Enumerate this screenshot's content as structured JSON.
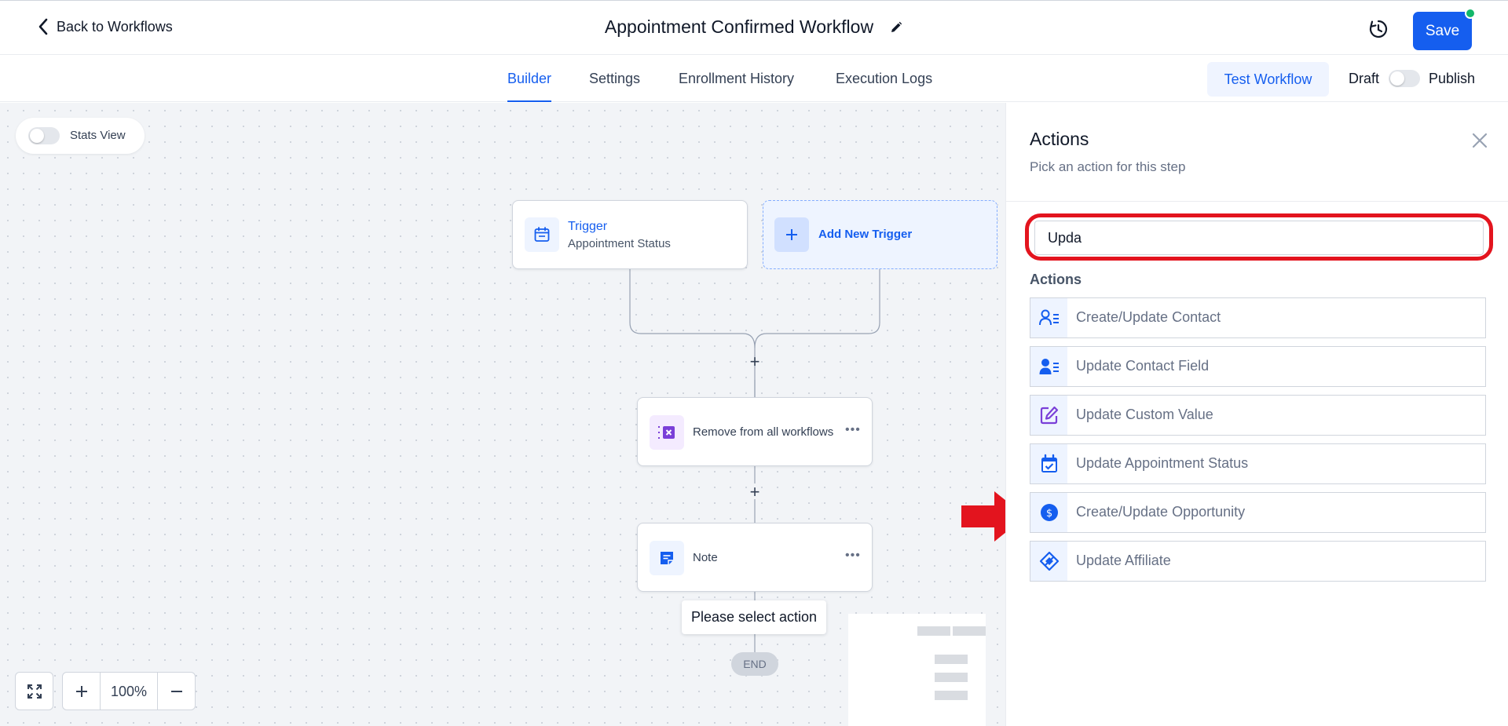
{
  "header": {
    "back_label": "Back to Workflows",
    "title": "Appointment Confirmed Workflow",
    "save_label": "Save"
  },
  "tabs": [
    {
      "label": "Builder",
      "active": true
    },
    {
      "label": "Settings",
      "active": false
    },
    {
      "label": "Enrollment History",
      "active": false
    },
    {
      "label": "Execution Logs",
      "active": false
    }
  ],
  "toolbar": {
    "test_label": "Test Workflow",
    "draft_label": "Draft",
    "publish_label": "Publish",
    "publish_on": false
  },
  "canvas": {
    "stats_label": "Stats View",
    "stats_on": false,
    "trigger": {
      "title": "Trigger",
      "subtitle": "Appointment Status"
    },
    "add_trigger_label": "Add New Trigger",
    "remove_node_label": "Remove from all workflows",
    "note_node_label": "Note",
    "tooltip": "Please select action",
    "end_label": "END",
    "zoom_label": "100%"
  },
  "panel": {
    "title": "Actions",
    "subtitle": "Pick an action for this step",
    "search_value": "Upda",
    "section_label": "Actions",
    "items": [
      {
        "label": "Create/Update Contact",
        "icon": "contact-list-icon"
      },
      {
        "label": "Update Contact Field",
        "icon": "contact-card-icon"
      },
      {
        "label": "Update Custom Value",
        "icon": "edit-square-icon"
      },
      {
        "label": "Update Appointment Status",
        "icon": "calendar-check-icon"
      },
      {
        "label": "Create/Update Opportunity",
        "icon": "dollar-circle-icon"
      },
      {
        "label": "Update Affiliate",
        "icon": "affiliate-tag-icon"
      }
    ]
  },
  "colors": {
    "primary": "#155eef",
    "highlight": "#e3141e",
    "canvas_bg": "#f2f4f7",
    "status_dot": "#12b76a",
    "purple_icon": "#7a3fd8"
  }
}
